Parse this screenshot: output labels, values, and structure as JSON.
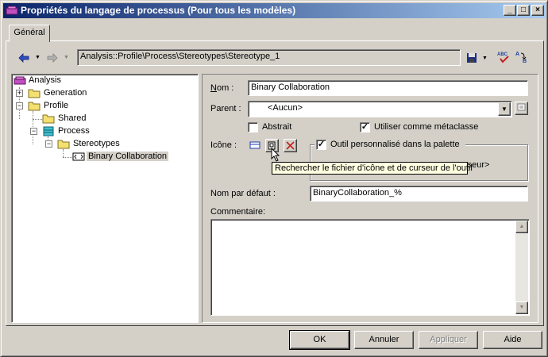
{
  "window": {
    "title": "Propriétés du langage de processus (Pour tous les modèles)",
    "minimize": "_",
    "maximize": "□",
    "close": "×"
  },
  "tab": {
    "label": "Général"
  },
  "toolbar": {
    "path": "Analysis::Profile\\Process\\Stereotypes\\Stereotype_1",
    "back_icon": "back-arrow-icon",
    "forward_icon": "forward-arrow-icon"
  },
  "tree": {
    "items": [
      {
        "label": "Analysis",
        "icon": "profile-icon"
      },
      {
        "label": "Generation",
        "icon": "folder-icon",
        "expander": "+"
      },
      {
        "label": "Profile",
        "icon": "folder-icon",
        "expander": "−"
      },
      {
        "label": "Shared",
        "icon": "folder-icon"
      },
      {
        "label": "Process",
        "icon": "metaclass-icon",
        "expander": "−"
      },
      {
        "label": "Stereotypes",
        "icon": "folder-icon",
        "expander": "−"
      },
      {
        "label": "Binary Collaboration",
        "icon": "stereotype-icon"
      }
    ]
  },
  "form": {
    "nom_label": "Nom :",
    "nom_value": "Binary Collaboration",
    "parent_label": "Parent :",
    "parent_value": "<Aucun>",
    "abstrait_label": "Abstrait",
    "abstrait_checked": "",
    "metaclasse_label": "Utiliser comme métaclasse",
    "metaclasse_checked": "✓",
    "icone_label": "Icône :",
    "outil_label": "Outil personnalisé dans la palette",
    "outil_checked": "✓",
    "partial_text": "rseur>",
    "nom_defaut_label": "Nom par défaut :",
    "nom_defaut_value": "BinaryCollaboration_%",
    "commentaire_label": "Commentaire:",
    "commentaire_value": ""
  },
  "tooltip": {
    "text": "Rechercher le fichier d'icône et de curseur de l'outil"
  },
  "buttons": {
    "ok": "OK",
    "annuler": "Annuler",
    "appliquer": "Appliquer",
    "aide": "Aide"
  },
  "colors": {
    "title_start": "#0a246a",
    "title_end": "#a6caf0",
    "face": "#d4d0c8",
    "tooltip_bg": "#ffffe1"
  }
}
